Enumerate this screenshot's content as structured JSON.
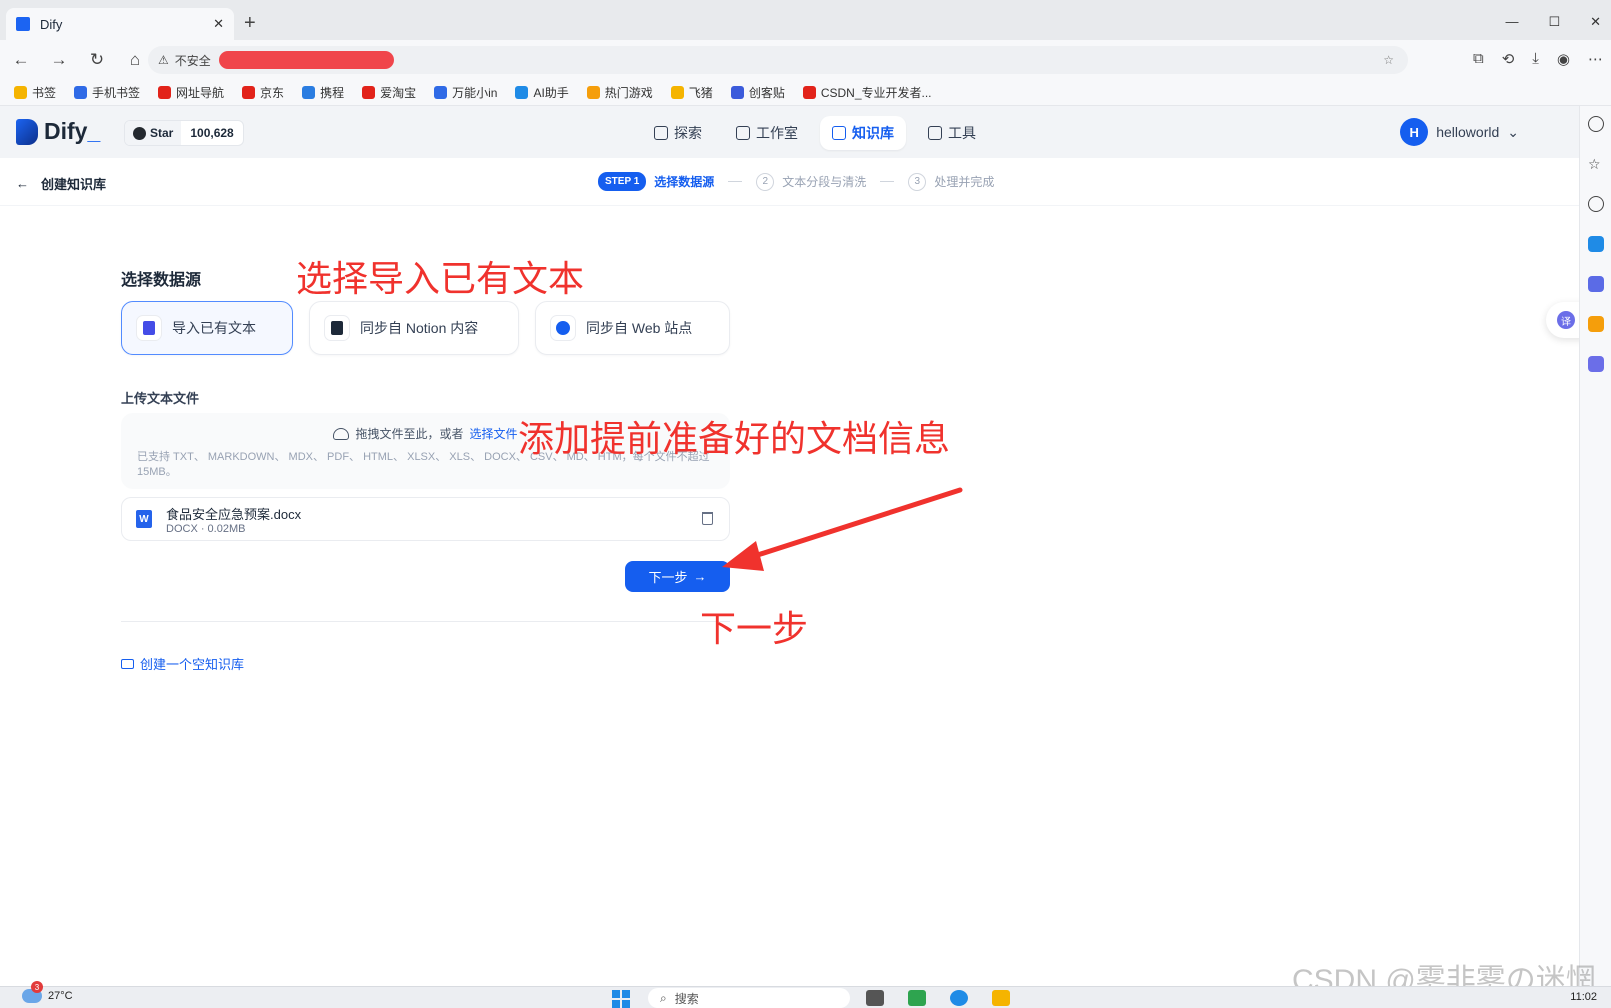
{
  "browser": {
    "tab_title": "Dify",
    "address_warning": "不安全",
    "bookmarks": [
      {
        "label": "书签",
        "color": "#f5b400"
      },
      {
        "label": "手机书签",
        "color": "#2f6ae6"
      },
      {
        "label": "网址导航",
        "color": "#e2231a"
      },
      {
        "label": "京东",
        "color": "#e2231a"
      },
      {
        "label": "携程",
        "color": "#2a7de1"
      },
      {
        "label": "爱淘宝",
        "color": "#e2231a"
      },
      {
        "label": "万能小in",
        "color": "#2f6ae6"
      },
      {
        "label": "AI助手",
        "color": "#1f8be6"
      },
      {
        "label": "热门游戏",
        "color": "#f59e0b"
      },
      {
        "label": "飞猪",
        "color": "#f5b400"
      },
      {
        "label": "创客贴",
        "color": "#3b5bdb"
      },
      {
        "label": "CSDN_专业开发者...",
        "color": "#e2231a"
      }
    ]
  },
  "header": {
    "logo_text": "Dify",
    "github_star": "Star",
    "github_count": "100,628",
    "nav": [
      {
        "label": "探索",
        "active": false
      },
      {
        "label": "工作室",
        "active": false
      },
      {
        "label": "知识库",
        "active": true
      },
      {
        "label": "工具",
        "active": false
      }
    ],
    "user_initial": "H",
    "user_name": "helloworld"
  },
  "subheader": {
    "back_label": "创建知识库",
    "step1_badge": "STEP 1",
    "step1_label": "选择数据源",
    "step2_num": "2",
    "step2_label": "文本分段与清洗",
    "step3_num": "3",
    "step3_label": "处理并完成"
  },
  "main": {
    "section_title": "选择数据源",
    "data_sources": [
      {
        "label": "导入已有文本",
        "active": true,
        "icon_color": "#444ce7"
      },
      {
        "label": "同步自 Notion 内容",
        "active": false,
        "icon_color": "#1d2939"
      },
      {
        "label": "同步自 Web 站点",
        "active": false,
        "icon_color": "#155eef"
      }
    ],
    "upload_label": "上传文本文件",
    "dropzone_text": "拖拽文件至此，或者",
    "dropzone_link": "选择文件",
    "dropzone_hint": "已支持 TXT、 MARKDOWN、 MDX、 PDF、 HTML、 XLSX、 XLS、 DOCX、 CSV、 MD、 HTM，每个文件不超过 15MB。",
    "file_name": "食品安全应急预案.docx",
    "file_meta": "DOCX · 0.02MB",
    "next_button": "下一步",
    "empty_link": "创建一个空知识库"
  },
  "annotations": {
    "a1": "选择导入已有文本",
    "a2": "添加提前准备好的文档信息",
    "a3": "下一步",
    "color": "#f0322d"
  },
  "watermark": "CSDN @雾非雾の迷惘",
  "taskbar": {
    "weather": "27°C",
    "weather_badge": "3",
    "search_placeholder": "搜索",
    "time": "11:02"
  }
}
